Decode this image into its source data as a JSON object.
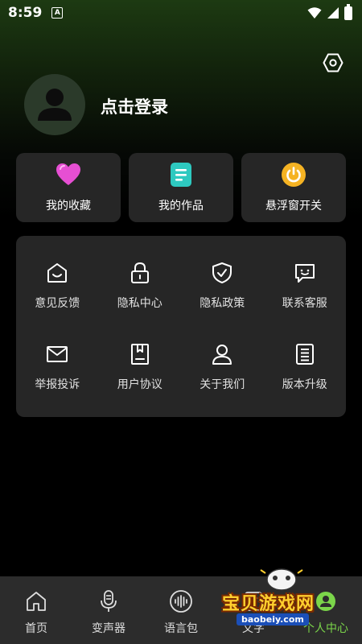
{
  "status_bar": {
    "time": "8:59",
    "notification_glyph": "A"
  },
  "profile": {
    "login_label": "点击登录"
  },
  "quick_actions": [
    {
      "label": "我的收藏",
      "icon": "heart-icon",
      "color": "#e64fd3"
    },
    {
      "label": "我的作品",
      "icon": "document-icon",
      "color": "#2ec9c0"
    },
    {
      "label": "悬浮窗开关",
      "icon": "power-icon",
      "color": "#f5b323"
    }
  ],
  "menu_grid": [
    {
      "label": "意见反馈",
      "icon": "feedback-icon"
    },
    {
      "label": "隐私中心",
      "icon": "lock-icon"
    },
    {
      "label": "隐私政策",
      "icon": "shield-check-icon"
    },
    {
      "label": "联系客服",
      "icon": "chat-smile-icon"
    },
    {
      "label": "举报投诉",
      "icon": "mail-icon"
    },
    {
      "label": "用户协议",
      "icon": "agreement-book-icon"
    },
    {
      "label": "关于我们",
      "icon": "person-icon"
    },
    {
      "label": "版本升级",
      "icon": "list-icon"
    }
  ],
  "tab_bar": [
    {
      "label": "首页",
      "icon": "home-icon"
    },
    {
      "label": "变声器",
      "icon": "microphone-icon"
    },
    {
      "label": "语言包",
      "icon": "voice-wave-icon"
    },
    {
      "label": "文字",
      "icon": "text-icon"
    },
    {
      "label": "个人中心",
      "icon": "user-center-icon",
      "active": true
    }
  ],
  "watermark": {
    "title": "宝贝游戏网",
    "url": "baobeiy.com"
  },
  "colors": {
    "active_tab": "#7bd64a",
    "card_bg": "#262626",
    "tabbar_bg": "#2c2c2c"
  }
}
